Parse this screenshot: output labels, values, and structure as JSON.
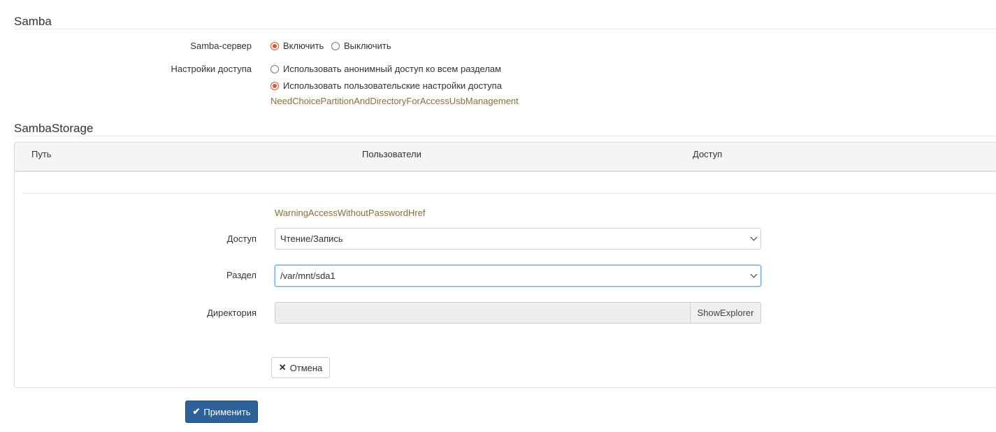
{
  "samba": {
    "title": "Samba",
    "server_label": "Samba-сервер",
    "enable_label": "Включить",
    "disable_label": "Выключить",
    "server_enabled": true,
    "access_label": "Настройки доступа",
    "anon_label": "Использовать анонимный доступ ко всем разделам",
    "custom_label": "Использовать пользовательские настройки доступа",
    "custom_selected": true,
    "need_choice_text": "NeedChoicePartitionAndDirectoryForAccessUsbManagement"
  },
  "storage": {
    "title": "SambaStorage",
    "columns": [
      "Путь",
      "Пользователи",
      "Доступ"
    ],
    "warning_text": "WarningAccessWithoutPasswordHref",
    "access_label": "Доступ",
    "access_value": "Чтение/Запись",
    "partition_label": "Раздел",
    "partition_value": "/var/mnt/sda1",
    "directory_label": "Директория",
    "directory_value": "",
    "show_explorer_label": "ShowExplorer",
    "cancel_label": "Отмена"
  },
  "apply_label": "Применить",
  "colors": {
    "accent_radio": "#e0532f",
    "link": "#8a6d3b",
    "primary": "#2d6197"
  },
  "icons": {
    "cancel": "close-icon",
    "apply": "check-icon"
  }
}
